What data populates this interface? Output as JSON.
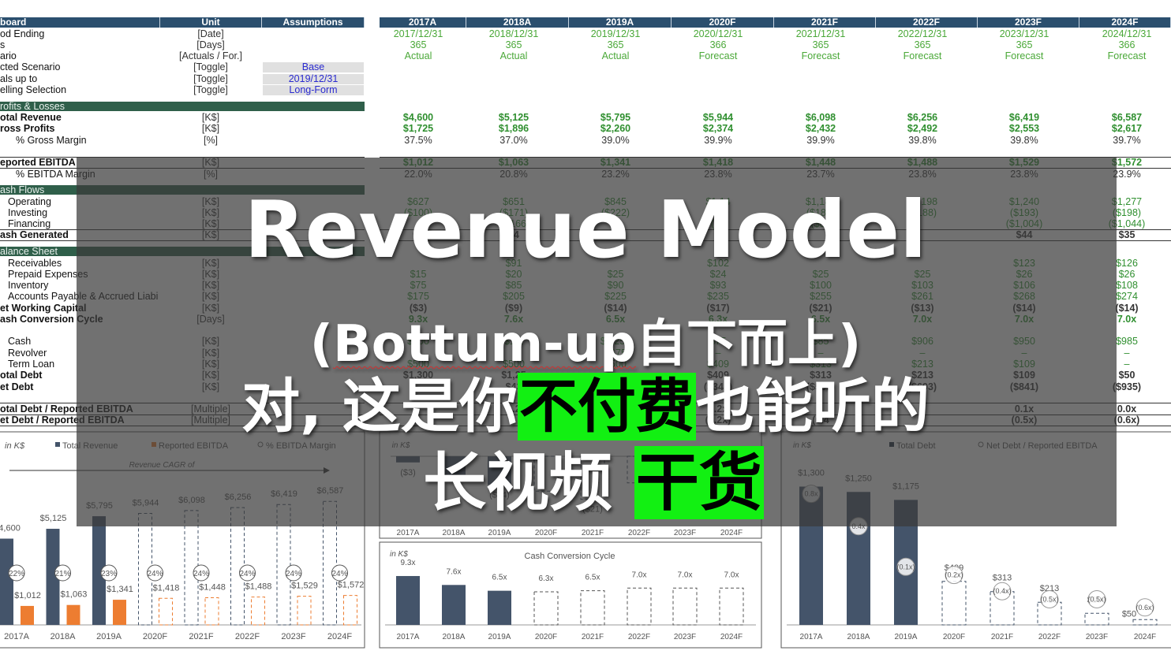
{
  "header": {
    "label_col": "board",
    "unit_col": "Unit",
    "assumptions_col": "Assumptions",
    "years": [
      "2017A",
      "2018A",
      "2019A",
      "2020F",
      "2021F",
      "2022F",
      "2023F",
      "2024F"
    ]
  },
  "top_rows": [
    {
      "label": "od Ending",
      "unit": "[Date]",
      "values": [
        "2017/12/31",
        "2018/12/31",
        "2019/12/31",
        "2020/12/31",
        "2021/12/31",
        "2022/12/31",
        "2023/12/31",
        "2024/12/31"
      ]
    },
    {
      "label": "s",
      "unit": "[Days]",
      "values": [
        "365",
        "365",
        "365",
        "366",
        "365",
        "365",
        "365",
        "366"
      ]
    },
    {
      "label": "ario",
      "unit": "[Actuals / For.]",
      "values": [
        "Actual",
        "Actual",
        "Actual",
        "Forecast",
        "Forecast",
        "Forecast",
        "Forecast",
        "Forecast"
      ]
    },
    {
      "label": "cted Scenario",
      "unit": "[Toggle]",
      "toggle": "Base"
    },
    {
      "label": "als up to",
      "unit": "[Toggle]",
      "toggle": "2019/12/31"
    },
    {
      "label": "elling Selection",
      "unit": "[Toggle]",
      "toggle": "Long-Form"
    }
  ],
  "sections": {
    "pl": "rofits & Losses",
    "cf": "ash Flows",
    "bs": "alance Sheet"
  },
  "rows": [
    {
      "label": "otal Revenue",
      "unit": "[K$]",
      "kind": "bold",
      "values": [
        "$4,600",
        "$5,125",
        "$5,795",
        "$5,944",
        "$6,098",
        "$6,256",
        "$6,419",
        "$6,587"
      ]
    },
    {
      "label": "ross Profits",
      "unit": "[K$]",
      "kind": "bold",
      "values": [
        "$1,725",
        "$1,896",
        "$2,260",
        "$2,374",
        "$2,432",
        "$2,492",
        "$2,553",
        "$2,617"
      ]
    },
    {
      "label": "% Gross Margin",
      "unit": "[%]",
      "kind": "pct",
      "values": [
        "37.5%",
        "37.0%",
        "39.0%",
        "39.9%",
        "39.9%",
        "39.8%",
        "39.8%",
        "39.7%"
      ]
    },
    {
      "label": "eported EBITDA",
      "unit": "[K$]",
      "kind": "bold",
      "values": [
        "$1,012",
        "$1,063",
        "$1,341",
        "$1,418",
        "$1,448",
        "$1,488",
        "$1,529",
        "$1,572"
      ]
    },
    {
      "label": "% EBITDA Margin",
      "unit": "[%]",
      "kind": "pct",
      "values": [
        "22.0%",
        "20.8%",
        "23.2%",
        "23.8%",
        "23.7%",
        "23.8%",
        "23.8%",
        "23.9%"
      ]
    },
    {
      "label": "Operating",
      "unit": "[K$]",
      "kind": "sub",
      "values": [
        "$627",
        "$651",
        "$845",
        "$1,14",
        "$1,182",
        "$1,198",
        "$1,240",
        "$1,277"
      ]
    },
    {
      "label": "Investing",
      "unit": "[K$]",
      "kind": "sub",
      "values": [
        "($100)",
        "($171)",
        "($222)",
        "($17",
        "($183)",
        "($188)",
        "($193)",
        "($198)"
      ]
    },
    {
      "label": "Financing",
      "unit": "[K$]",
      "kind": "sub",
      "values": [
        "",
        "($166",
        "",
        "($1",
        "($89",
        "",
        "($1,004)",
        "($1,044)"
      ]
    },
    {
      "label": "ash Generated",
      "unit": "[K$]",
      "kind": "total",
      "values": [
        "07",
        "14",
        "$4",
        "",
        "",
        "",
        "$44",
        "$35"
      ]
    },
    {
      "label": "Receivables",
      "unit": "[K$]",
      "kind": "sub",
      "values": [
        "",
        "$91",
        "",
        "$102",
        "",
        "",
        "$123",
        "$126"
      ]
    },
    {
      "label": "Prepaid Expenses",
      "unit": "[K$]",
      "kind": "sub",
      "values": [
        "$15",
        "$20",
        "$25",
        "$24",
        "$25",
        "$25",
        "$26",
        "$26"
      ]
    },
    {
      "label": "Inventory",
      "unit": "[K$]",
      "kind": "sub",
      "values": [
        "$75",
        "$85",
        "$90",
        "$93",
        "$100",
        "$103",
        "$106",
        "$108"
      ]
    },
    {
      "label": "Accounts Payable & Accrued Liabi",
      "unit": "[K$]",
      "kind": "sub",
      "values": [
        "$175",
        "$205",
        "$225",
        "$235",
        "$255",
        "$261",
        "$268",
        "$274"
      ]
    },
    {
      "label": "et Working Capital",
      "unit": "[K$]",
      "kind": "total",
      "values": [
        "($3)",
        "($9)",
        "($14)",
        "($17)",
        "($21)",
        "($13)",
        "($14)",
        "($14)"
      ]
    },
    {
      "label": "ash Conversion Cycle",
      "unit": "[Days]",
      "kind": "bold",
      "values": [
        "9.3x",
        "7.6x",
        "6.5x",
        "6.3x",
        "6.5x",
        "7.0x",
        "7.0x",
        "7.0x"
      ]
    },
    {
      "label": "Cash",
      "unit": "[K$]",
      "kind": "sub",
      "values": [
        "$500",
        "$1,2",
        "$1,250",
        "$75",
        "$85",
        "$906",
        "$950",
        "$985"
      ]
    },
    {
      "label": "Revolver",
      "unit": "[K$]",
      "kind": "sub",
      "values": [
        "",
        "",
        "$675",
        "–",
        "–",
        "–",
        "–",
        "–"
      ]
    },
    {
      "label": "Term Loan",
      "unit": "[K$]",
      "kind": "sub",
      "values": [
        "$500",
        "$500",
        "$500",
        "$409",
        "$313",
        "$213",
        "$109",
        "–"
      ]
    },
    {
      "label": "otal Debt",
      "unit": "[K$]",
      "kind": "total",
      "values": [
        "$1,300",
        "$1,25",
        "",
        "$409",
        "$313",
        "$213",
        "$109",
        "$50"
      ]
    },
    {
      "label": "et Debt",
      "unit": "[K$]",
      "kind": "total",
      "values": [
        "",
        "$43",
        "",
        "($342)",
        "($539)",
        "($693)",
        "($841)",
        "($935)"
      ]
    },
    {
      "label": "otal Debt / Reported EBITDA",
      "unit": "[Multiple]",
      "kind": "total",
      "values": [
        "",
        "1.2",
        "",
        "0.2x",
        "",
        "",
        "0.1x",
        "0.0x"
      ]
    },
    {
      "label": "et Debt / Reported EBITDA",
      "unit": "[Multiple]",
      "kind": "total",
      "values": [
        "",
        "",
        "",
        "(0.2x)",
        "(0.4",
        "",
        "(0.5x)",
        "(0.6x)"
      ]
    }
  ],
  "chart_data": [
    {
      "type": "bar",
      "unit_note": "in K$",
      "annotation": "Revenue CAGR of",
      "categories": [
        "2017A",
        "2018A",
        "2019A",
        "2020F",
        "2021F",
        "2022F",
        "2023F",
        "2024F"
      ],
      "series": [
        {
          "name": "Total Revenue",
          "values": [
            4600,
            5125,
            5795,
            5944,
            6098,
            6256,
            6419,
            6587
          ],
          "labels": [
            "$4,600",
            "$5,125",
            "$5,795",
            "$5,944",
            "$6,098",
            "$6,256",
            "$6,419",
            "$6,587"
          ]
        },
        {
          "name": "Reported EBITDA",
          "values": [
            1012,
            1063,
            1341,
            1418,
            1448,
            1488,
            1529,
            1572
          ],
          "labels": [
            "$1,012",
            "$1,063",
            "$1,341",
            "$1,418",
            "$1,448",
            "$1,488",
            "$1,529",
            "$1,572"
          ]
        },
        {
          "name": "% EBITDA Margin",
          "values": [
            22,
            21,
            23,
            24,
            24,
            24,
            24,
            24
          ],
          "labels": [
            "22%",
            "21%",
            "23%",
            "24%",
            "24%",
            "24%",
            "24%",
            "24%"
          ]
        }
      ],
      "forecast_from": "2020F",
      "colors": {
        "revenue": "#44546a",
        "ebitda": "#ed7d31"
      }
    },
    {
      "type": "bar",
      "unit_note": "in K$",
      "categories": [
        "2017A",
        "2018A",
        "2019A",
        "2020F",
        "2021F",
        "2022F",
        "2023F",
        "2024F"
      ],
      "values": [
        -3,
        -9,
        -14,
        -17,
        -21,
        -13,
        -14,
        -14
      ],
      "labels": [
        "($3)",
        "",
        "($14)",
        "",
        "($21)",
        "",
        "",
        ""
      ]
    },
    {
      "type": "bar",
      "unit_note": "in K$",
      "title": "Cash Conversion Cycle",
      "categories": [
        "2017A",
        "2018A",
        "2019A",
        "2020F",
        "2021F",
        "2022F",
        "2023F",
        "2024F"
      ],
      "values": [
        9.3,
        7.6,
        6.5,
        6.3,
        6.5,
        7.0,
        7.0,
        7.0
      ],
      "labels": [
        "9.3x",
        "7.6x",
        "6.5x",
        "6.3x",
        "6.5x",
        "7.0x",
        "7.0x",
        "7.0x"
      ]
    },
    {
      "type": "bar",
      "unit_note": "in K$",
      "categories": [
        "2017A",
        "2018A",
        "2019A",
        "2020F",
        "2021F",
        "2022F",
        "2023F",
        "2024F"
      ],
      "series": [
        {
          "name": "Total Debt",
          "values": [
            1300,
            1250,
            1175,
            409,
            313,
            213,
            109,
            50
          ],
          "labels": [
            "$1,300",
            "$1,250",
            "$1,175",
            "$409",
            "$313",
            "$213",
            "$109",
            "$50"
          ]
        },
        {
          "name": "Net Debt / Reported EBITDA",
          "values": [
            0.8,
            0.4,
            -0.1,
            -0.2,
            -0.4,
            -0.5,
            -0.5,
            -0.6
          ],
          "labels": [
            "0.8x",
            "0.4x",
            "(0.1x)",
            "(0.2x)",
            "(0.4x)",
            "(0.5x)",
            "(0.5x)",
            "(0.6x)"
          ]
        }
      ]
    }
  ],
  "overlay": {
    "title": "Revenue Model",
    "subtitle_a": "(",
    "subtitle_b": "Bottum-up",
    "subtitle_c": "自下而上)",
    "line3_a": "对, 这是你",
    "line3_hi": "不付费",
    "line3_b": "也能听的",
    "line4_a": "长视频 ",
    "line4_hi": "干货",
    "highlight_color": "#12f012"
  }
}
